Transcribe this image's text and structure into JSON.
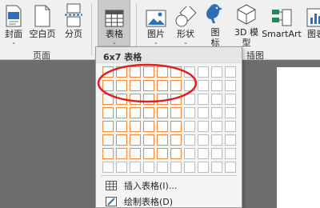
{
  "ribbon": {
    "buttons": {
      "cover": {
        "label": "封面",
        "icon": "cover-page-icon"
      },
      "blank": {
        "label": "空白页",
        "icon": "blank-page-icon"
      },
      "pagebreak": {
        "label": "分页",
        "icon": "page-break-icon"
      },
      "table": {
        "label": "表格",
        "icon": "table-icon"
      },
      "pictures": {
        "label": "图片",
        "icon": "picture-icon"
      },
      "shapes": {
        "label": "形状",
        "icon": "shapes-icon"
      },
      "icons": {
        "label": "图\n标",
        "icon": "icons-icon"
      },
      "model3d": {
        "label": "3D 模\n型",
        "icon": "3d-model-icon"
      },
      "smartart": {
        "label": "SmartArt",
        "icon": "smartart-icon"
      },
      "chart": {
        "label": "图表",
        "icon": "chart-icon"
      }
    },
    "groups": {
      "pages": "页面",
      "illustrations": "插图"
    }
  },
  "table_dropdown": {
    "header": "6x7 表格",
    "grid": {
      "columns": 10,
      "rows": 8,
      "selected_columns": 6,
      "selected_rows": 7
    },
    "menu_items": [
      {
        "label": "插入表格(I)...",
        "icon": "insert-table-icon"
      },
      {
        "label": "绘制表格(D)",
        "icon": "draw-table-icon"
      }
    ]
  },
  "colors": {
    "selection": "#f08a3c",
    "annotation": "#e02020",
    "active_button": "#c9c9c9"
  }
}
